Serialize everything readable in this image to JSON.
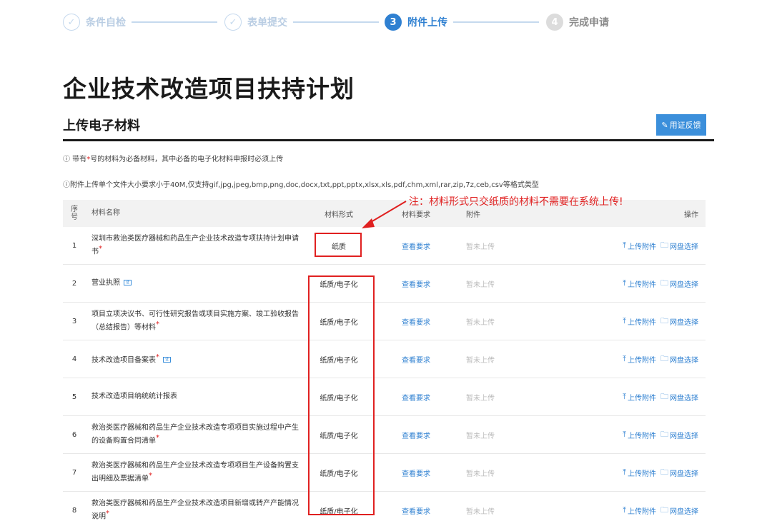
{
  "steps": [
    {
      "num": "✓",
      "label": "条件自检",
      "state": "done"
    },
    {
      "num": "✓",
      "label": "表单提交",
      "state": "done"
    },
    {
      "num": "3",
      "label": "附件上传",
      "state": "active"
    },
    {
      "num": "4",
      "label": "完成申请",
      "state": "todo"
    }
  ],
  "page_title": "企业技术改造项目扶持计划",
  "section": {
    "title": "上传电子材料",
    "feedback_label": "用证反馈"
  },
  "notes": {
    "note1_prefix": "ⓘ 带有",
    "note1_star": "*",
    "note1_suffix": "号的材料为必备材料，其中必备的电子化材料申报时必须上传",
    "note2": "ⓘ附件上传单个文件大小要求小于40M,仅支持gif,jpg,jpeg,bmp,png,doc,docx,txt,ppt,pptx,xlsx,xls,pdf,chm,xml,rar,zip,7z,ceb,csv等格式类型"
  },
  "annotation": "注：材料形式只交纸质的材料不需要在系统上传!",
  "table": {
    "headers": {
      "no": "序号",
      "name": "材料名称",
      "form": "材料形式",
      "req": "材料要求",
      "att": "附件",
      "op": "操作"
    },
    "rows": [
      {
        "no": "1",
        "name": "深圳市救治类医疗器械和药品生产企业技术改造专项扶持计划申请书",
        "star": true,
        "badge": false,
        "form": "纸质",
        "req": "查看要求",
        "att": "暂未上传",
        "upload": "上传附件",
        "disk": "网盘选择"
      },
      {
        "no": "2",
        "name": "营业执照",
        "star": false,
        "badge": true,
        "form": "纸质/电子化",
        "req": "查看要求",
        "att": "暂未上传",
        "upload": "上传附件",
        "disk": "网盘选择"
      },
      {
        "no": "3",
        "name": "项目立项决议书、可行性研究报告或项目实施方案、竣工验收报告（总结报告）等材料",
        "star": true,
        "badge": false,
        "form": "纸质/电子化",
        "req": "查看要求",
        "att": "暂未上传",
        "upload": "上传附件",
        "disk": "网盘选择"
      },
      {
        "no": "4",
        "name": "技术改造项目备案表",
        "star": true,
        "badge": true,
        "form": "纸质/电子化",
        "req": "查看要求",
        "att": "暂未上传",
        "upload": "上传附件",
        "disk": "网盘选择"
      },
      {
        "no": "5",
        "name": "技术改造项目纳统统计报表",
        "star": false,
        "badge": false,
        "form": "纸质/电子化",
        "req": "查看要求",
        "att": "暂未上传",
        "upload": "上传附件",
        "disk": "网盘选择"
      },
      {
        "no": "6",
        "name": "救治类医疗器械和药品生产企业技术改造专项项目实施过程中产生的设备购置合同清单",
        "star": true,
        "badge": false,
        "form": "纸质/电子化",
        "req": "查看要求",
        "att": "暂未上传",
        "upload": "上传附件",
        "disk": "网盘选择"
      },
      {
        "no": "7",
        "name": "救治类医疗器械和药品生产企业技术改造专项项目生产设备购置支出明细及票据清单",
        "star": true,
        "badge": false,
        "form": "纸质/电子化",
        "req": "查看要求",
        "att": "暂未上传",
        "upload": "上传附件",
        "disk": "网盘选择"
      },
      {
        "no": "8",
        "name": "救治类医疗器械和药品生产企业技术改造项目新增或转产产能情况说明",
        "star": true,
        "badge": false,
        "form": "纸质/电子化",
        "req": "查看要求",
        "att": "暂未上传",
        "upload": "上传附件",
        "disk": "网盘选择"
      }
    ]
  },
  "icons": {
    "check": "check-icon",
    "edit": "edit-icon",
    "upload": "upload-icon",
    "folder": "folder-icon"
  },
  "colors": {
    "accent": "#2f80d1",
    "annotation_red": "#e02020",
    "header_bg": "#f2f2f2"
  }
}
